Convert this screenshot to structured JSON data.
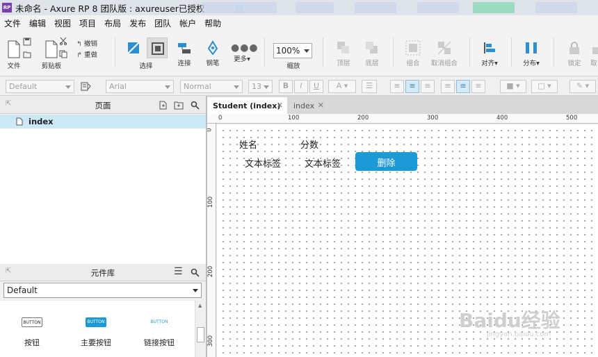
{
  "window": {
    "title": "未命名 - Axure RP 8 团队版 : axureuser已授权",
    "app_icon": "RP"
  },
  "menu": [
    "文件",
    "编辑",
    "视图",
    "项目",
    "布局",
    "发布",
    "团队",
    "帐户",
    "帮助"
  ],
  "toolbar": {
    "file": "文件",
    "clipboard": "剪贴板",
    "undo": "撤销",
    "redo": "重做",
    "select": "选择",
    "connect": "连接",
    "pen": "钢笔",
    "more": "更多▾",
    "zoom_value": "100%",
    "zoom_label": "缩放",
    "top": "顶层",
    "bottom": "底层",
    "group": "组合",
    "ungroup": "取消组合",
    "align": "对齐▾",
    "distribute": "分布▾",
    "lock": "锁定",
    "cancel": "取"
  },
  "formatbar": {
    "style": "Default",
    "font": "Arial",
    "weight": "Normal",
    "size": "13"
  },
  "pages_panel": {
    "title": "页面",
    "pages": [
      "index"
    ]
  },
  "library_panel": {
    "title": "元件库",
    "selected": "Default",
    "widgets": [
      {
        "preview": "BUTTON",
        "label": "按钮"
      },
      {
        "preview": "BUTTON",
        "label": "主要按钮"
      },
      {
        "preview": "BUTTON",
        "label": "链接按钮"
      }
    ]
  },
  "tabs": [
    {
      "label": "Student (index)",
      "active": true
    },
    {
      "label": "index",
      "active": false
    }
  ],
  "ruler": {
    "top": [
      "0",
      "100",
      "200",
      "300",
      "400",
      "500"
    ],
    "left": [
      "0",
      "100",
      "200",
      "300"
    ]
  },
  "canvas": {
    "header_name": "姓名",
    "header_score": "分数",
    "cell_name": "文本标签",
    "cell_score": "文本标签",
    "delete_button": "删除"
  },
  "watermark": {
    "main": "Baidu经验",
    "sub": "jingyan.baidu.com"
  },
  "colors": {
    "primary_button": "#1b9ad6",
    "selected_page": "#cde8f7",
    "title_bar": "#dfe3ea"
  }
}
